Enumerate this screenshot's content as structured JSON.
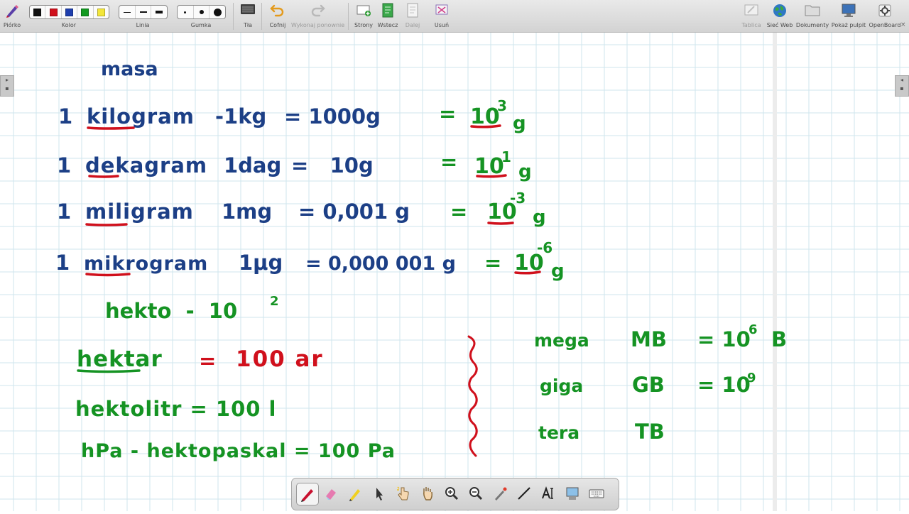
{
  "toolbar": {
    "pen_label": "Piórko",
    "color_label": "Kolor",
    "line_label": "Linia",
    "eraser_label": "Gumka",
    "backgrounds_label": "Tła",
    "undo_label": "Cofnij",
    "redo_label": "Wykonaj ponownie",
    "pages_label": "Strony",
    "back_label": "Wstecz",
    "next_label": "Dalej",
    "delete_label": "Usuń",
    "board_label": "Tablica",
    "web_label": "Sieć Web",
    "documents_label": "Dokumenty",
    "desktop_label": "Pokaż pulpit",
    "openboard_label": "OpenBoard",
    "colors": [
      "#111111",
      "#d0101c",
      "#1f3fae",
      "#129a20",
      "#f3e63a"
    ]
  },
  "board": {
    "masa": "masa",
    "rows": [
      {
        "num": "1",
        "name": "kilogram",
        "unit": "-1kg",
        "eq": "= 1000g",
        "pow_eq": "=",
        "base": "10",
        "exp": "3",
        "g": "g"
      },
      {
        "num": "1",
        "name": "dekagram",
        "unit": "1dag",
        "eq": "=   10g",
        "pow_eq": "=",
        "base": "10",
        "exp": "1",
        "g": "g"
      },
      {
        "num": "1",
        "name": "miligram",
        "unit": "1mg",
        "eq": "= 0,001 g",
        "pow_eq": "=",
        "base": "10",
        "exp": "-3",
        "g": "g"
      },
      {
        "num": "1",
        "name": "mikrogram",
        "unit": "1μg",
        "eq": "= 0,000 001 g",
        "pow_eq": "=",
        "base": "10",
        "exp": "-6",
        "g": "g"
      }
    ],
    "hekto": "hekto  -  10",
    "hekto_exp": "2",
    "hektar_word": "hektar",
    "hektar_eq": "=",
    "hektar_val": "100 ar",
    "hektolitr": "hektolitr = 100 l",
    "hpa": "hPa - hektopaskal = 100 Pa",
    "prefixes": [
      {
        "name": "mega",
        "unit": "MB",
        "eq": "= 10",
        "exp": "6",
        "tail": "B"
      },
      {
        "name": "giga",
        "unit": "GB",
        "eq": "= 10",
        "exp": "9",
        "tail": ""
      },
      {
        "name": "tera",
        "unit": "TB",
        "eq": "",
        "exp": "",
        "tail": ""
      }
    ]
  },
  "colors": {
    "blue_ink": "#1c3f86",
    "red_ink": "#d0101c",
    "green_ink": "#159323",
    "grid": "#cfe6ee"
  }
}
